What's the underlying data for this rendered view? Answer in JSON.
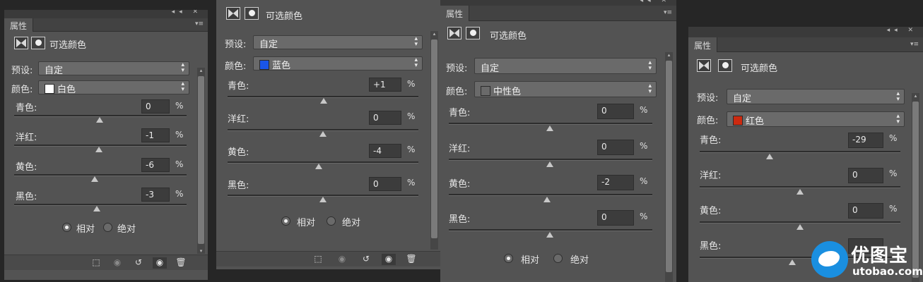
{
  "common": {
    "tab_label": "属性",
    "title": "可选颜色",
    "preset_label": "预设:",
    "color_label": "颜色:",
    "pct": "%",
    "relative": "相对",
    "absolute": "绝对",
    "collapse": "◂◂",
    "close": "✕",
    "menu": "▾≡"
  },
  "panels": [
    {
      "preset": "自定",
      "color": {
        "name": "白色",
        "swatch": "#ffffff"
      },
      "sliders": [
        {
          "label": "青色:",
          "value": "0",
          "level": 0.0
        },
        {
          "label": "洋红:",
          "value": "-1",
          "level": -0.01
        },
        {
          "label": "黄色:",
          "value": "-6",
          "level": -0.06
        },
        {
          "label": "黑色:",
          "value": "-3",
          "level": -0.03
        }
      ],
      "mode": "relative"
    },
    {
      "preset": "自定",
      "color": {
        "name": "蓝色",
        "swatch": "#1a55e8"
      },
      "sliders": [
        {
          "label": "青色:",
          "value": "+1",
          "level": 0.01
        },
        {
          "label": "洋红:",
          "value": "0",
          "level": 0.0
        },
        {
          "label": "黄色:",
          "value": "-4",
          "level": -0.04
        },
        {
          "label": "黑色:",
          "value": "0",
          "level": 0.0
        }
      ],
      "mode": "relative"
    },
    {
      "preset": "自定",
      "color": {
        "name": "中性色",
        "swatch": "#6a6a6a"
      },
      "sliders": [
        {
          "label": "青色:",
          "value": "0",
          "level": 0.0
        },
        {
          "label": "洋红:",
          "value": "0",
          "level": 0.0
        },
        {
          "label": "黄色:",
          "value": "-2",
          "level": -0.02
        },
        {
          "label": "黑色:",
          "value": "0",
          "level": 0.0
        }
      ],
      "mode": "relative"
    },
    {
      "preset": "自定",
      "color": {
        "name": "红色",
        "swatch": "#cc2a10"
      },
      "sliders": [
        {
          "label": "青色:",
          "value": "-29",
          "level": -0.29
        },
        {
          "label": "洋红:",
          "value": "0",
          "level": 0.0
        },
        {
          "label": "黄色:",
          "value": "0",
          "level": 0.0
        },
        {
          "label": "黑色:",
          "value": "",
          "level": 0.0
        }
      ],
      "mode": "relative"
    }
  ],
  "footer_icons": [
    "clip-to-layer-icon",
    "view-previous-icon",
    "reset-icon",
    "visibility-eye-icon",
    "trash-icon"
  ],
  "watermark": {
    "cn": "优图宝",
    "en": "utobao.com",
    "brand_color": "#1a8fe0"
  }
}
